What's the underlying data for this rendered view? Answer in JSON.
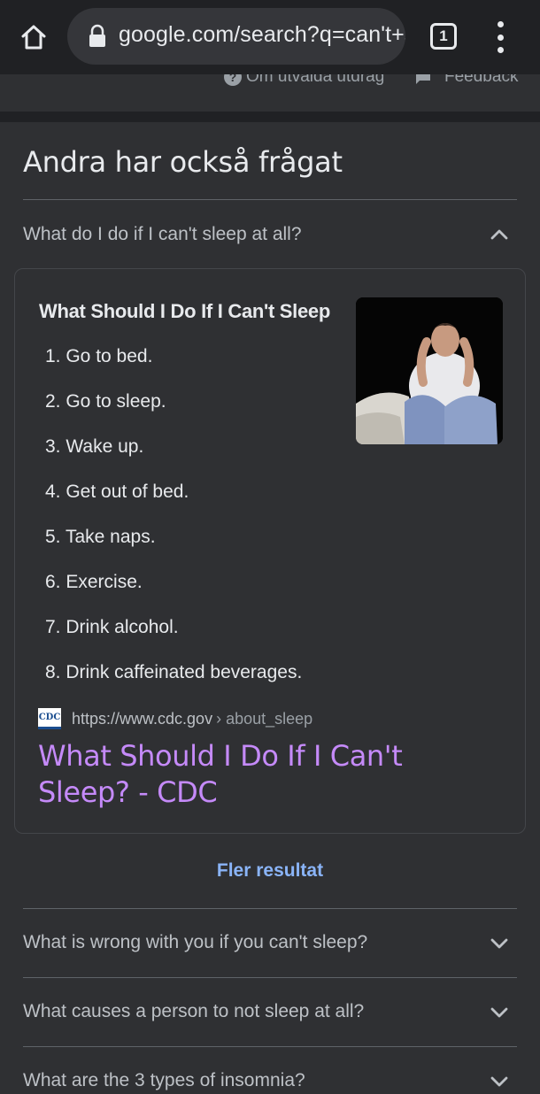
{
  "browser": {
    "url": "google.com/search?q=can't+sleep",
    "tab_count": "1"
  },
  "top_links": {
    "about_snippets": "Om utvalda utdrag",
    "feedback": "Feedback"
  },
  "paa": {
    "title": "Andra har också frågat",
    "expanded": {
      "question": "What do I do if I can't sleep at all?",
      "heading": "What Should I Do If I Can't Sleep",
      "steps": [
        "1. Go to bed.",
        "2. Go to sleep.",
        "3. Wake up.",
        "4. Get out of bed.",
        "5. Take naps.",
        "6. Exercise.",
        "7. Drink alcohol.",
        "8. Drink caffeinated beverages."
      ],
      "source_favicon": "CDC",
      "source_url": "https://www.cdc.gov",
      "source_path": "› about_sleep",
      "result_title": "What Should I Do If I Can't Sleep? - CDC"
    },
    "more_results": "Fler resultat",
    "questions": [
      "What is wrong with you if you can't sleep?",
      "What causes a person to not sleep at all?",
      "What are the 3 types of insomnia?"
    ]
  },
  "colors": {
    "background": "#2f3033",
    "bar": "#202124",
    "link_visited": "#c58af9",
    "link": "#8ab4f8"
  }
}
